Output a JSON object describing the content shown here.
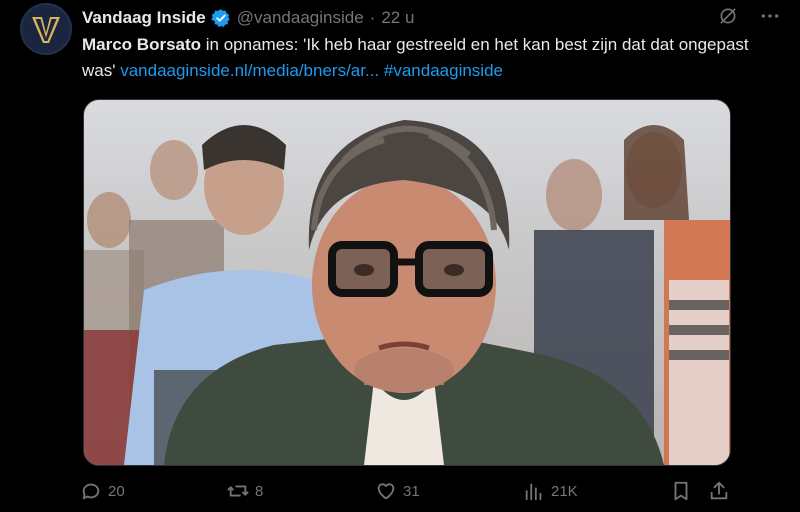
{
  "account": {
    "name": "Vandaag Inside",
    "handle": "@vandaaginside",
    "time": "22 u",
    "separator": "·",
    "avatar_letter": "V"
  },
  "tweet": {
    "bold_name": "Marco Borsato",
    "text": " in opnames: 'Ik heb haar gestreeld en het kan best zijn dat dat ongepast was' ",
    "link": "vandaaginside.nl/media/bners/ar...",
    "hashtag": "#vandaaginside"
  },
  "media": {
    "icon": "photo"
  },
  "actions": {
    "replies": "20",
    "reposts": "8",
    "likes": "31",
    "views": "21K"
  },
  "colors": {
    "background": "#000000",
    "link": "#1d9bf0",
    "muted": "#71767b",
    "verified": "#1d9bf0"
  }
}
